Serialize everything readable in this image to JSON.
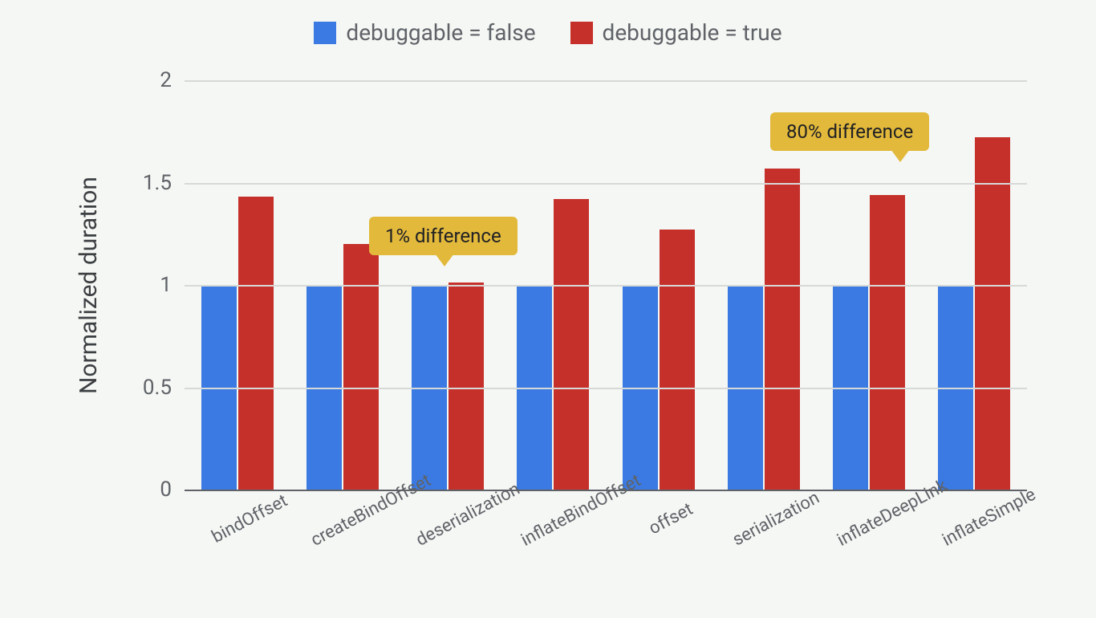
{
  "chart_data": {
    "type": "bar",
    "ylabel": "Normalized duration",
    "xlabel": "",
    "ylim": [
      0,
      2
    ],
    "yticks": [
      0,
      0.5,
      1,
      1.5,
      2
    ],
    "categories": [
      "bindOffset",
      "createBindOffset",
      "deserialization",
      "inflateBindOffset",
      "offset",
      "serialization",
      "inflateDeepLink",
      "inflateSimple"
    ],
    "series": [
      {
        "name": "debuggable = false",
        "color": "#3a7ae2",
        "values": [
          1.0,
          1.0,
          1.0,
          1.0,
          1.0,
          1.0,
          1.0,
          1.0
        ]
      },
      {
        "name": "debuggable = true",
        "color": "#c5302a",
        "values": [
          1.43,
          1.2,
          1.01,
          1.42,
          1.27,
          1.57,
          1.44,
          1.72
        ]
      }
    ],
    "annotations": [
      {
        "text": "1% difference",
        "target_category": "deserialization"
      },
      {
        "text": "80% difference",
        "target_category": "inflateSimple"
      }
    ]
  },
  "legend": {
    "items": [
      {
        "label": "debuggable = false",
        "swatch": "#3a7ae2"
      },
      {
        "label": "debuggable = true",
        "swatch": "#c5302a"
      }
    ]
  },
  "annotations": {
    "a1": "1% difference",
    "a2": "80% difference"
  }
}
